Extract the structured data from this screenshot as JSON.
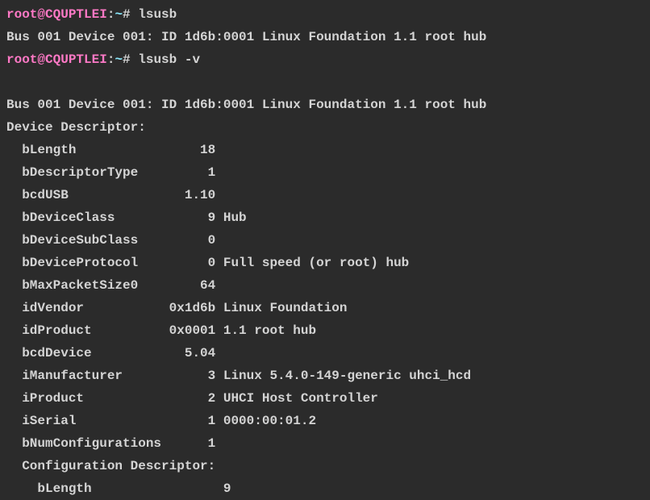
{
  "prompt1": {
    "user": "root",
    "at": "@",
    "host": "CQUPTLEI",
    "colon": ":",
    "path": "~",
    "hash": "# ",
    "command": "lsusb"
  },
  "output1": "Bus 001 Device 001: ID 1d6b:0001 Linux Foundation 1.1 root hub",
  "prompt2": {
    "user": "root",
    "at": "@",
    "host": "CQUPTLEI",
    "colon": ":",
    "path": "~",
    "hash": "# ",
    "command": "lsusb -v"
  },
  "blank1": " ",
  "output2_header": "Bus 001 Device 001: ID 1d6b:0001 Linux Foundation 1.1 root hub",
  "device_descriptor_label": "Device Descriptor:",
  "descriptors": {
    "bLength": "  bLength                18",
    "bDescriptorType": "  bDescriptorType         1",
    "bcdUSB": "  bcdUSB               1.10",
    "bDeviceClass": "  bDeviceClass            9 Hub",
    "bDeviceSubClass": "  bDeviceSubClass         0 ",
    "bDeviceProtocol": "  bDeviceProtocol         0 Full speed (or root) hub",
    "bMaxPacketSize0": "  bMaxPacketSize0        64",
    "idVendor": "  idVendor           0x1d6b Linux Foundation",
    "idProduct": "  idProduct          0x0001 1.1 root hub",
    "bcdDevice": "  bcdDevice            5.04",
    "iManufacturer": "  iManufacturer           3 Linux 5.4.0-149-generic uhci_hcd",
    "iProduct": "  iProduct                2 UHCI Host Controller",
    "iSerial": "  iSerial                 1 0000:00:01.2",
    "bNumConfigurations": "  bNumConfigurations      1"
  },
  "config_descriptor_label": "  Configuration Descriptor:",
  "partial_line": "    bLength                 9"
}
